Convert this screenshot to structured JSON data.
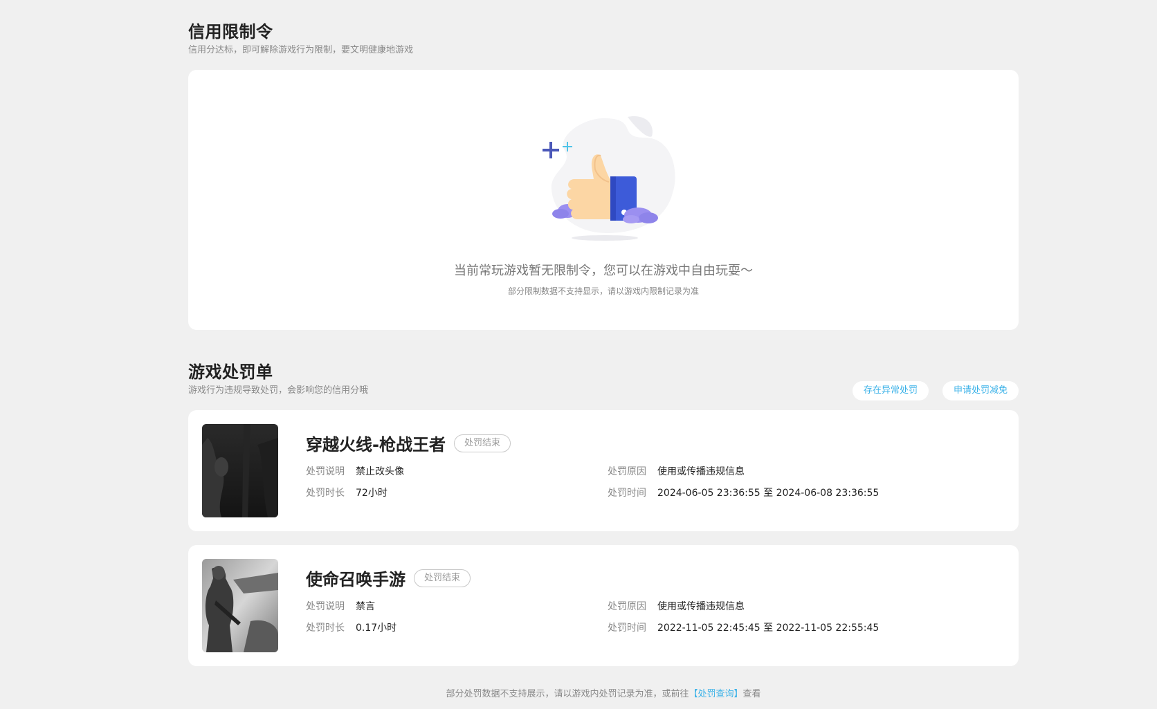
{
  "credit_limit": {
    "title": "信用限制令",
    "subtitle": "信用分达标，即可解除游戏行为限制，要文明健康地游戏",
    "empty_message": "当前常玩游戏暂无限制令，您可以在游戏中自由玩耍～",
    "empty_note": "部分限制数据不支持显示，请以游戏内限制记录为准"
  },
  "penalties": {
    "title": "游戏处罚单",
    "subtitle": "游戏行为违规导致处罚，会影响您的信用分哦",
    "actions": {
      "abnormal": "存在异常处罚",
      "appeal": "申请处罚减免"
    },
    "labels": {
      "desc": "处罚说明",
      "duration": "处罚时长",
      "reason": "处罚原因",
      "time": "处罚时间",
      "to": "至"
    },
    "items": [
      {
        "game": "穿越火线-枪战王者",
        "status": "处罚结束",
        "desc": "禁止改头像",
        "duration": "72小时",
        "reason": "使用或传播违规信息",
        "start": "2024-06-05 23:36:55",
        "end": "2024-06-08 23:36:55"
      },
      {
        "game": "使命召唤手游",
        "status": "处罚结束",
        "desc": "禁言",
        "duration": "0.17小时",
        "reason": "使用或传播违规信息",
        "start": "2022-11-05 22:45:45",
        "end": "2022-11-05 22:55:45"
      }
    ]
  },
  "footer": {
    "before": "部分处罚数据不支持展示，请以游戏内处罚记录为准，或前往",
    "link": "【处罚查询】",
    "after": "查看"
  },
  "colors": {
    "accent": "#3bb2e8",
    "background": "#f0f0f0",
    "card": "#ffffff"
  }
}
